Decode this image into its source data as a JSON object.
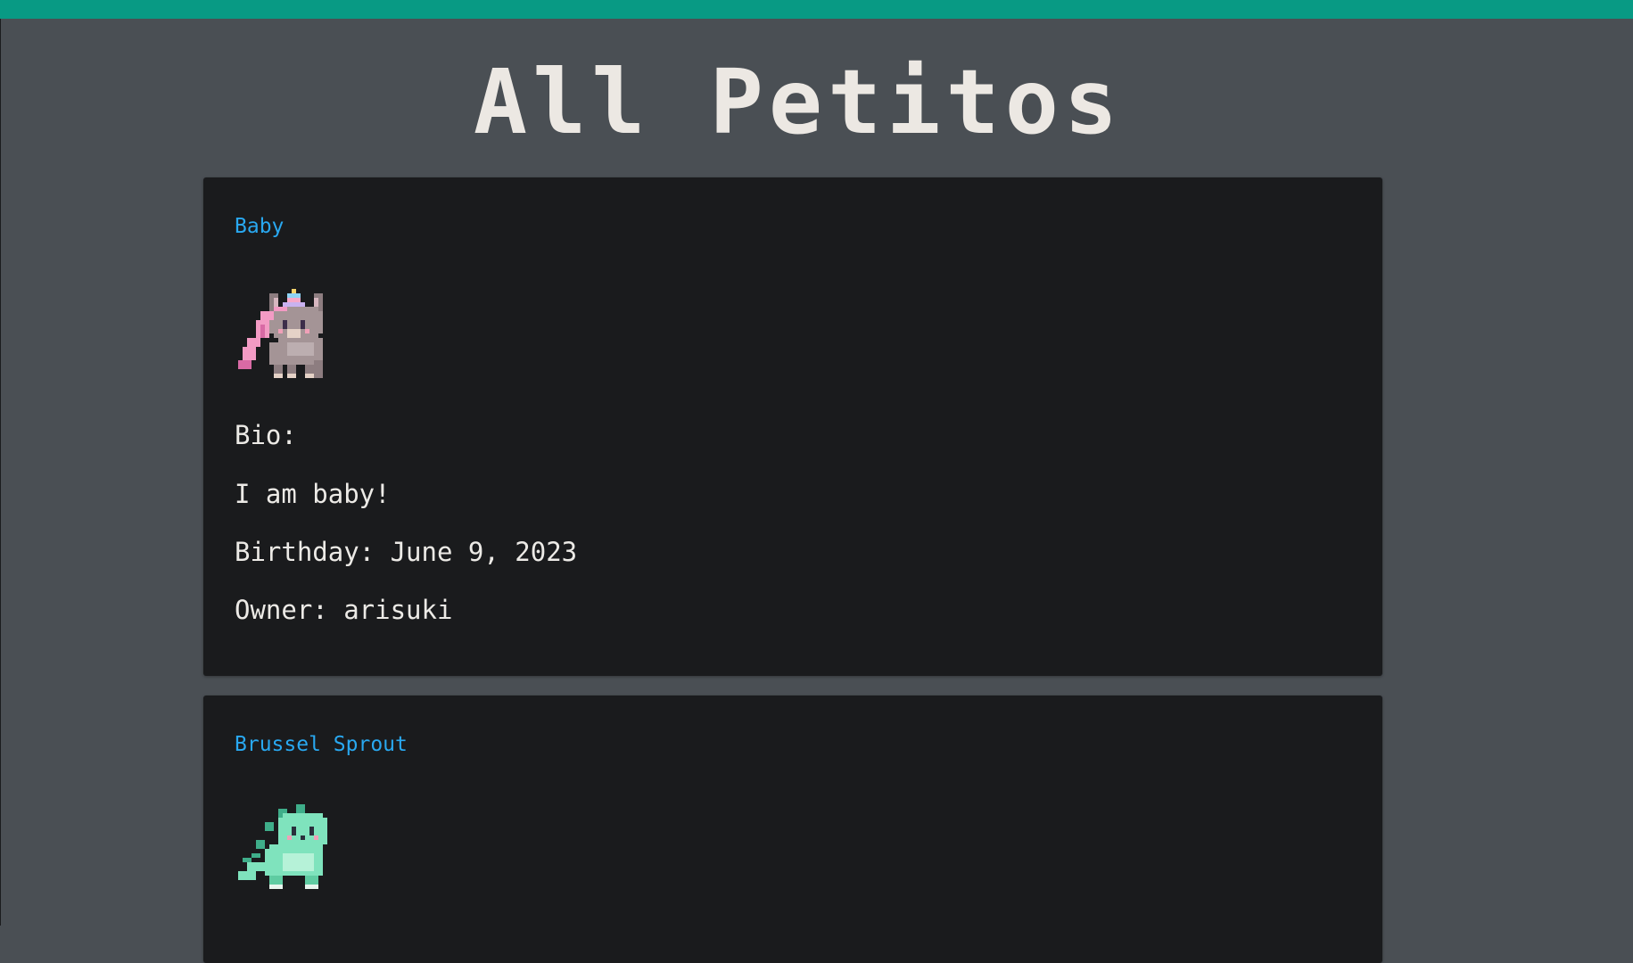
{
  "page": {
    "title": "All Petitos",
    "accent_color": "#089a84",
    "background_color": "#4a4f54",
    "card_color": "#1a1b1d",
    "link_color": "#29a8f0"
  },
  "pets": [
    {
      "name": "Baby",
      "image_icon": "unicorn-pixel-icon",
      "bio_label": "Bio:",
      "bio": "I am baby!",
      "birthday": "Birthday: June 9, 2023",
      "owner": "Owner: arisuki"
    },
    {
      "name": "Brussel Sprout",
      "image_icon": "dinosaur-pixel-icon"
    }
  ]
}
